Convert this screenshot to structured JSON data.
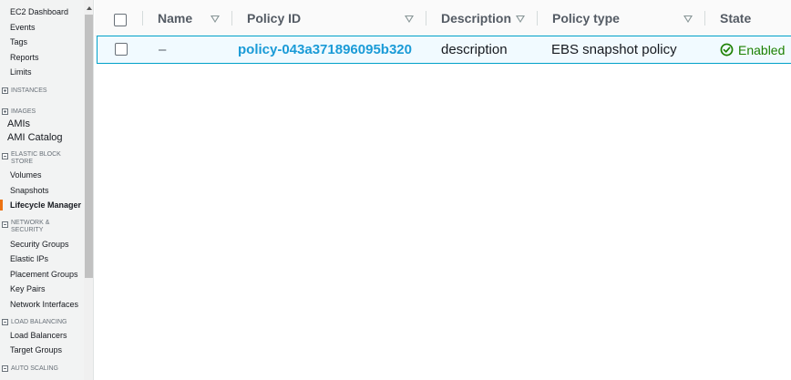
{
  "sidebar": {
    "top_links": [
      "EC2 Dashboard",
      "Events",
      "Tags",
      "Reports",
      "Limits"
    ],
    "sections": {
      "instances": "INSTANCES",
      "images": "IMAGES",
      "elastic_block_store": "ELASTIC BLOCK STORE",
      "network_security": "NETWORK & SECURITY",
      "load_balancing": "LOAD BALANCING",
      "auto_scaling": "AUTO SCALING"
    },
    "images_items": [
      "AMIs",
      "AMI Catalog"
    ],
    "ebs_items": [
      "Volumes",
      "Snapshots",
      "Lifecycle Manager"
    ],
    "network_items": [
      "Security Groups",
      "Elastic IPs",
      "Placement Groups",
      "Key Pairs",
      "Network Interfaces"
    ],
    "lb_items": [
      "Load Balancers",
      "Target Groups"
    ],
    "active_item": "Lifecycle Manager",
    "accent_color": "#ec7211"
  },
  "table": {
    "columns": [
      "Name",
      "Policy ID",
      "Description",
      "Policy type",
      "State"
    ],
    "rows": [
      {
        "name": "–",
        "policy_id": "policy-043a371896095b320",
        "description": "description",
        "policy_type": "EBS snapshot policy",
        "state": "Enabled",
        "state_icon": "check-circle-icon"
      }
    ],
    "link_color": "#1a9bd7",
    "status_color": "#1d8102",
    "selected_row_border": "#00a1c9"
  }
}
